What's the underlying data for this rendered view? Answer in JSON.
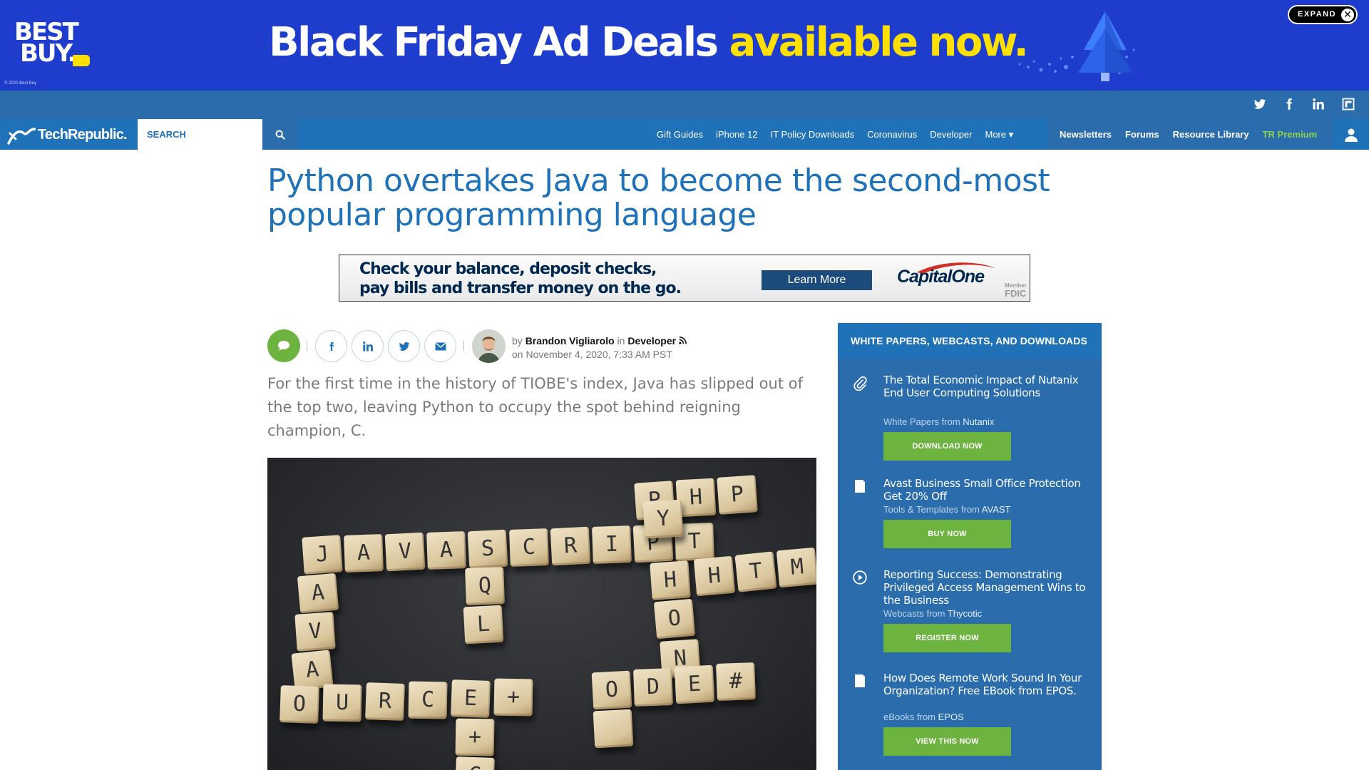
{
  "ad_top": {
    "logo_line1": "BEST",
    "logo_line2": "BUY.",
    "copyright": "© 2020 Best Buy",
    "headline_white": "Black Friday Ad Deals ",
    "headline_yellow": "available now.",
    "expand_label": "EXPAND",
    "close_glyph": "✕",
    "colors": {
      "background": "#1f3dcc",
      "accent": "#ffe000"
    }
  },
  "social": {
    "icons": [
      "twitter-icon",
      "facebook-icon",
      "linkedin-icon",
      "flipboard-icon"
    ]
  },
  "nav": {
    "logo": "TechRepublic.",
    "search_placeholder": "SEARCH",
    "links": [
      "Gift Guides",
      "iPhone 12",
      "IT Policy Downloads",
      "Coronavirus",
      "Developer",
      "More ▾"
    ],
    "right_links": [
      "Newsletters",
      "Forums",
      "Resource Library",
      "TR Premium"
    ],
    "colors": {
      "primary": "#1f72b8",
      "secondary": "#2a6cac",
      "premium": "#8ed34a"
    }
  },
  "article": {
    "title": "Python overtakes Java to become the second-most popular programming language",
    "author_prefix": "by",
    "author": "Brandon Vigliarolo",
    "in_label": "in",
    "category": "Developer",
    "date_prefix": "on",
    "date": "November 4, 2020, 7:33 AM PST",
    "dek": "For the first time in the history of TIOBE's index, Java has slipped out of the top two, leaving Python to occupy the spot behind reigning champion, C.",
    "share_icons": [
      "comment-icon",
      "facebook-icon",
      "linkedin-icon",
      "twitter-icon",
      "email-icon"
    ]
  },
  "ad_inline": {
    "line1": "Check your balance, deposit checks,",
    "line2": "pay bills and transfer money on the go.",
    "cta": "Learn More",
    "brand": "CapitalOne",
    "fdic_line1": "Member",
    "fdic_line2": "FDIC"
  },
  "hero_tiles": [
    "J",
    "A",
    "V",
    "A",
    "S",
    "C",
    "R",
    "I",
    "P",
    "T",
    "A",
    "V",
    "A",
    "Q",
    "L",
    "P",
    "H",
    "P",
    "Y",
    "H",
    "O",
    "N",
    "H",
    "T",
    "M",
    "L",
    "S",
    "O",
    "U",
    "R",
    "C",
    "E",
    "+",
    "+",
    "C",
    "O",
    "D",
    "E",
    "#"
  ],
  "sidebar": {
    "heading": "WHITE PAPERS, WEBCASTS, AND DOWNLOADS",
    "from_label": "from",
    "items": [
      {
        "icon": "paperclip-icon",
        "title": "The Total Economic Impact of Nutanix End User Computing Solutions",
        "type": "White Papers",
        "source": "Nutanix",
        "button": "DOWNLOAD NOW"
      },
      {
        "icon": "document-icon",
        "title": "Avast Business Small Office Protection Get 20% Off",
        "type": "Tools & Templates",
        "source": "AVAST",
        "button": "BUY NOW"
      },
      {
        "icon": "play-circle-icon",
        "title": "Reporting Success: Demonstrating Privileged Access Management Wins to the Business",
        "type": "Webcasts",
        "source": "Thycotic",
        "button": "REGISTER NOW"
      },
      {
        "icon": "document-icon",
        "title": "How Does Remote Work Sound In Your Organization? Free EBook from EPOS.",
        "type": "eBooks",
        "source": "EPOS",
        "button": "VIEW THIS NOW"
      }
    ]
  }
}
